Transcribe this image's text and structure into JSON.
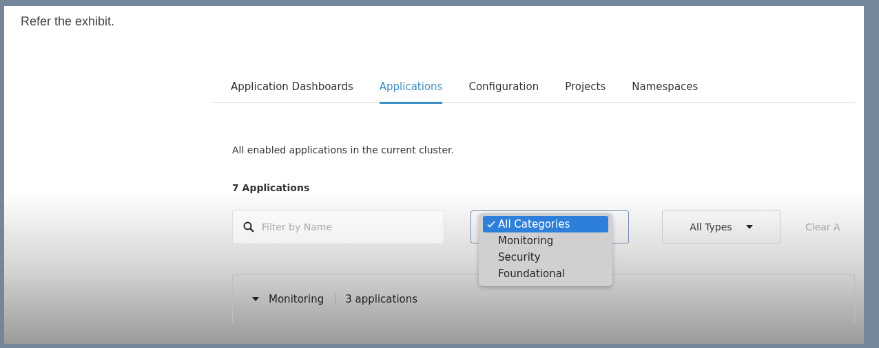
{
  "prompt": "Refer the exhibit.",
  "tabs": [
    {
      "label": "Application Dashboards",
      "selected": false
    },
    {
      "label": "Applications",
      "selected": true
    },
    {
      "label": "Configuration",
      "selected": false
    },
    {
      "label": "Projects",
      "selected": false
    },
    {
      "label": "Namespaces",
      "selected": false
    }
  ],
  "description": "All enabled applications in the current cluster.",
  "count": "7 Applications",
  "search": {
    "placeholder": "Filter by Name"
  },
  "category_filter": {
    "expanded": true,
    "options": [
      {
        "label": "All Categories",
        "selected": true
      },
      {
        "label": "Monitoring",
        "selected": false
      },
      {
        "label": "Security",
        "selected": false
      },
      {
        "label": "Foundational",
        "selected": false
      }
    ]
  },
  "type_filter": {
    "value": "All Types"
  },
  "clear_link": "Clear A",
  "groups": [
    {
      "name": "Monitoring",
      "count": "3 applications",
      "expanded": true
    }
  ]
}
